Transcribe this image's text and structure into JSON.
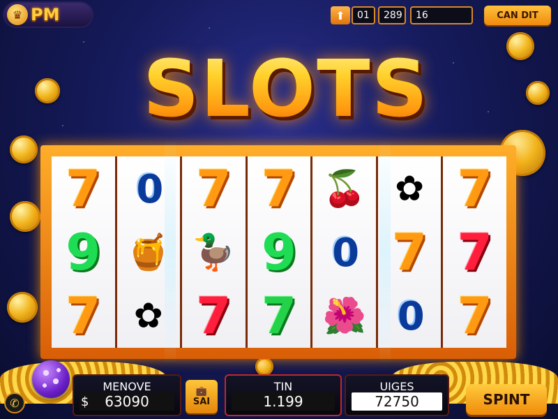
{
  "header": {
    "logo_text": "PM",
    "logo_icon": "crown-coin-icon",
    "up_icon": "arrow-up-icon",
    "stat1": "01",
    "stat2": "289",
    "stat3": "16",
    "credit_button": "CAN DIT"
  },
  "title": "SLOTS",
  "reels": [
    [
      {
        "s": "7",
        "c": "s7o"
      },
      {
        "s": "9",
        "c": "s9"
      },
      {
        "s": "7",
        "c": "s7o"
      }
    ],
    [
      {
        "s": "0",
        "c": "s0"
      },
      {
        "s": "🍯",
        "c": "glyph"
      },
      {
        "s": "✿",
        "c": "glyph"
      }
    ],
    [
      {
        "s": "7",
        "c": "s7o"
      },
      {
        "s": "🦆",
        "c": "glyph"
      },
      {
        "s": "7",
        "c": "s7r"
      }
    ],
    [
      {
        "s": "7",
        "c": "s7o"
      },
      {
        "s": "9",
        "c": "s9"
      },
      {
        "s": "7",
        "c": "s7g"
      }
    ],
    [
      {
        "s": "🍒",
        "c": "glyph"
      },
      {
        "s": "0",
        "c": "s0"
      },
      {
        "s": "🌺",
        "c": "glyph"
      }
    ],
    [
      {
        "s": "✿",
        "c": "glyph"
      },
      {
        "s": "7",
        "c": "s7o"
      },
      {
        "s": "0",
        "c": "s0"
      }
    ],
    [
      {
        "s": "7",
        "c": "s7o"
      },
      {
        "s": "7",
        "c": "s7r"
      },
      {
        "s": "7",
        "c": "s7o"
      }
    ]
  ],
  "footer": {
    "panel1_label": "MENOVE",
    "panel1_currency": "$",
    "panel1_value": "63090",
    "save_label": "SAI",
    "panel2_label": "TIN",
    "panel2_value": "1.199",
    "panel3_label": "UIGES",
    "panel3_value": "72750",
    "spin_label": "SPINT",
    "phone_icon": "phone-icon"
  },
  "colors": {
    "accent": "#f59a12",
    "background": "#151a5a"
  }
}
